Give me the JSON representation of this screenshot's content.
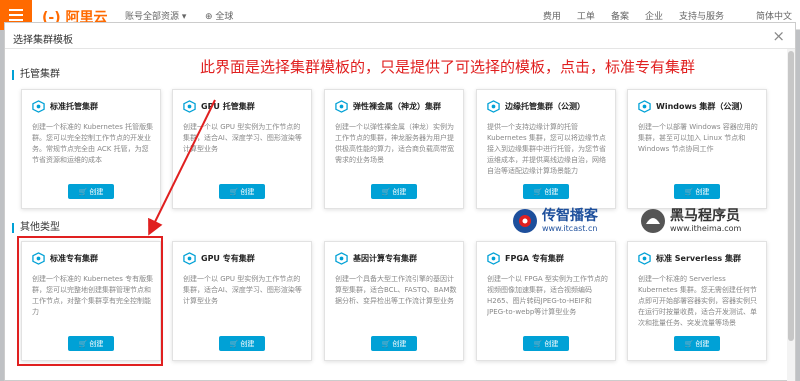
{
  "topbar": {
    "logo": "(-) 阿里云",
    "account": "账号全部资源 ▾",
    "global": "⊕ 全球",
    "nav": [
      "费用",
      "工单",
      "备案",
      "企业",
      "支持与服务",
      "",
      "简体中文"
    ]
  },
  "modal": {
    "title": "选择集群模板",
    "close": "×"
  },
  "sections": {
    "managed": "托管集群",
    "other": "其他类型"
  },
  "annotation": "此界面是选择集群模板的，只是提供了可选择的模板，点击，标准专有集群",
  "create_label": "创建",
  "cards": [
    {
      "title": "标准托管集群",
      "desc": "创建一个标准的 Kubernetes 托管版集群。您可以完全控制工作节点的开发业务。常规节点完全由 ACK 托管，为您节省资源和运维的成本"
    },
    {
      "title": "GPU 托管集群",
      "desc": "创建一个以 GPU 型实例为工作节点的集群，适合AI、深度学习、图形渲染等计算型业务"
    },
    {
      "title": "弹性裸金属（神龙）集群",
      "desc": "创建一个以弹性裸金属（神龙）实例为工作节点的集群，神龙服务器为用户提供极高性能的算力，适合商负载高带宽需求的业务场景"
    },
    {
      "title": "边缘托管集群（公测）",
      "desc": "提供一个支持边缘计算的托管 Kubernetes 集群，您可以将边缘节点接入到边缘集群中进行托管，为您节省运维成本，并提供离线边缘自治，网络自治等适配边缘计算场景能力"
    },
    {
      "title": "Windows 集群（公测）",
      "desc": "创建一个以部署 Windows 容器应用的集群，甚至可以加入 Linux 节点和 Windows 节点协同工作"
    },
    {
      "title": "标准专有集群",
      "desc": "创建一个标准的 Kubernetes 专有版集群，您可以完整地创建集群管理节点和工作节点，对整个集群享有完全控制能力"
    },
    {
      "title": "GPU 专有集群",
      "desc": "创建一个以 GPU 型实例为工作节点的集群，适合AI、深度学习、图形渲染等计算型业务"
    },
    {
      "title": "基因计算专有集群",
      "desc": "创建一个具备大型工作流引擎的基因计算型集群，适合BCL、FASTQ、BAM数据分析、变异检出等工作流计算型业务"
    },
    {
      "title": "FPGA 专有集群",
      "desc": "创建一个以 FPGA 型实例为工作节点的视频图像加速集群，适合视频编码H265、图片转码JPEG-to-HEIF和JPEG-to-webp等计算型业务"
    },
    {
      "title": "标准 Serverless 集群",
      "desc": "创建一个标准的 Serverless Kubernetes 集群。您无需创建任何节点即可开始部署容器实例，容器实例只在运行时按量收费，适合开发测试、单次和批量任务、突发流量等场景"
    }
  ],
  "watermarks": [
    {
      "name": "传智播客",
      "url": "www.itcast.cn"
    },
    {
      "name": "黑马程序员",
      "url": "www.itheima.com"
    }
  ],
  "colors": {
    "accent": "#00a1d6",
    "highlight": "#e02020",
    "brand": "#ff6a00"
  }
}
